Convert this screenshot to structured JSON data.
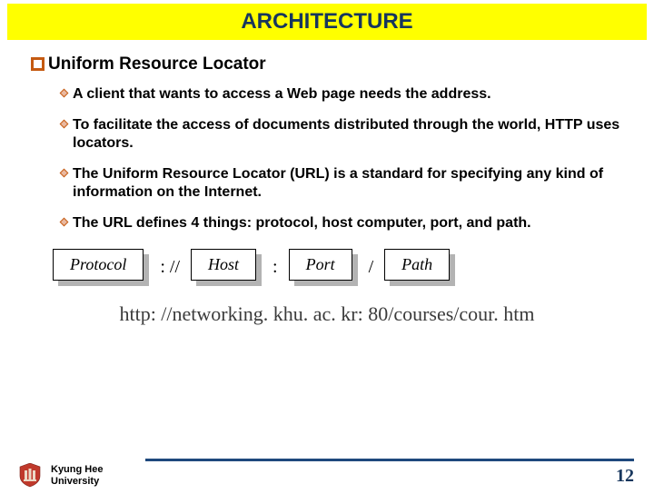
{
  "title": "ARCHITECTURE",
  "heading": "Uniform Resource Locator",
  "bullets": [
    "A client that wants to access a Web page needs the address.",
    "To facilitate the access of documents distributed through the world, HTTP uses locators.",
    "The Uniform Resource Locator (URL) is a standard for specifying any kind of information on the Internet.",
    "The URL defines 4 things: protocol, host computer, port, and path."
  ],
  "url_parts": {
    "protocol": "Protocol",
    "host": "Host",
    "port": "Port",
    "path": "Path",
    "sep_scheme": ":  //",
    "sep_colon": ":",
    "sep_slash": "/"
  },
  "example_url": "http: //networking. khu. ac. kr: 80/courses/cour. htm",
  "university": {
    "line1": "Kyung Hee",
    "line2": "University"
  },
  "page_number": "12"
}
